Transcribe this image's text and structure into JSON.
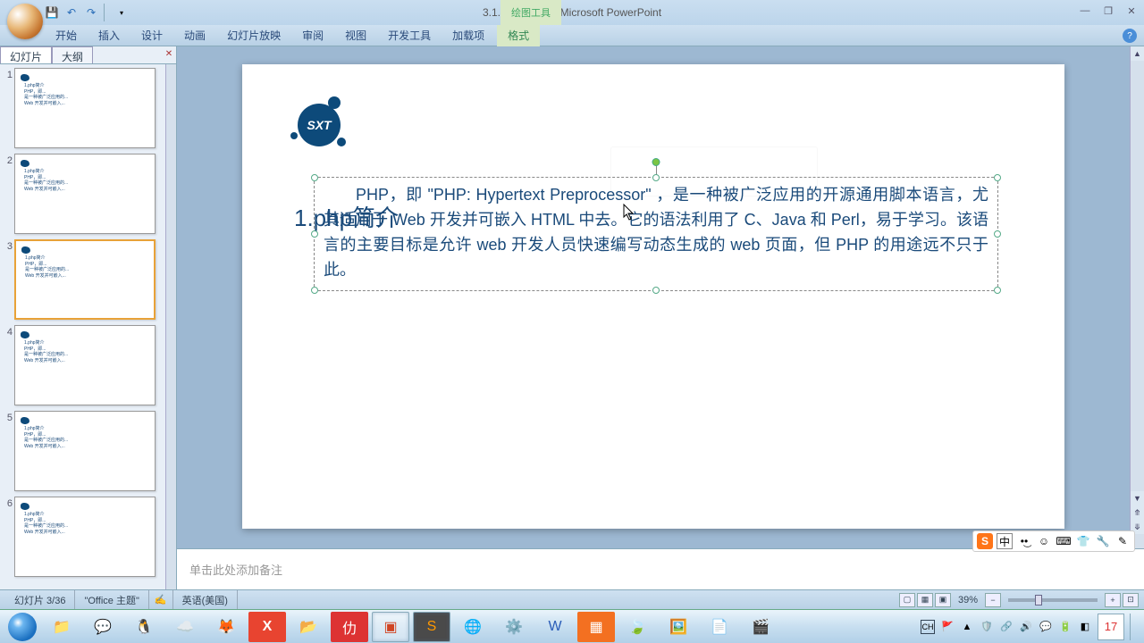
{
  "title": "3.1.1 php.pptx - Microsoft PowerPoint",
  "contextual_tab_group": "绘图工具",
  "ribbon": {
    "tabs": [
      "开始",
      "插入",
      "设计",
      "动画",
      "幻灯片放映",
      "审阅",
      "视图",
      "开发工具",
      "加载项"
    ],
    "contextual": "格式"
  },
  "panel": {
    "tab_slides": "幻灯片",
    "tab_outline": "大纲"
  },
  "slide": {
    "logo_text": "SXT",
    "title": "1.php简介",
    "body": "PHP，即 \"PHP: Hypertext Preprocessor\" ，是一种被广泛应用的开源通用脚本语言，尤其适用于 Web 开发并可嵌入 HTML 中去。它的语法利用了 C、Java 和 Perl，易于学习。该语言的主要目标是允许 web 开发人员快速编写动态生成的 web 页面，但 PHP 的用途远不只于此。"
  },
  "notes": {
    "placeholder": "单击此处添加备注"
  },
  "status": {
    "slide_pos": "幻灯片 3/36",
    "theme": "\"Office 主题\"",
    "lang": "英语(美国)",
    "zoom": "39%"
  },
  "tray": {
    "ime_mode": "中",
    "date": "17"
  },
  "thumbs": [
    {
      "n": "1",
      "sel": false
    },
    {
      "n": "2",
      "sel": false
    },
    {
      "n": "3",
      "sel": true
    },
    {
      "n": "4",
      "sel": false
    },
    {
      "n": "5",
      "sel": false
    },
    {
      "n": "6",
      "sel": false
    }
  ]
}
